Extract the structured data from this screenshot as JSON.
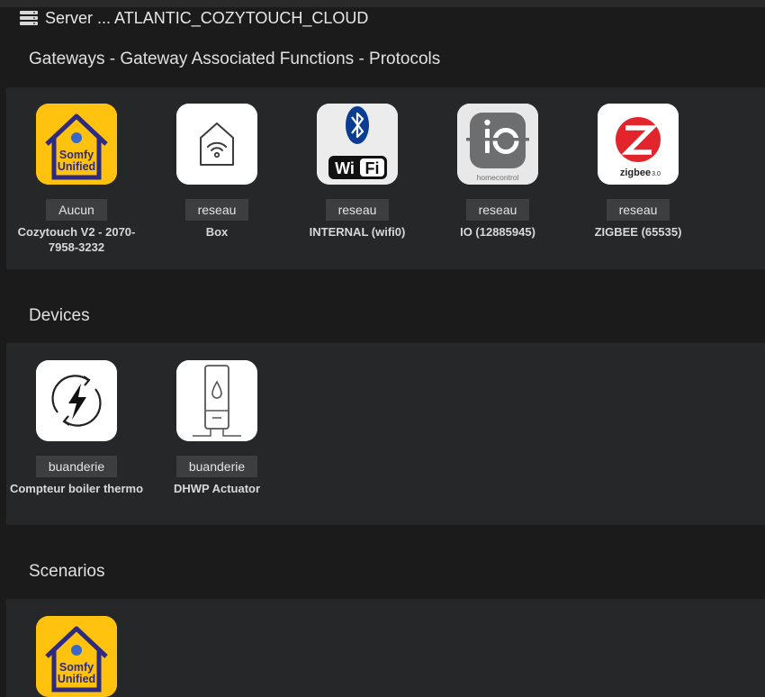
{
  "header": {
    "server_title": "Server ... ATLANTIC_COZYTOUCH_CLOUD"
  },
  "sections": {
    "gateways": {
      "title": "Gateways - Gateway Associated Functions - Protocols",
      "items": [
        {
          "badge": "Aucun",
          "label": "Cozytouch V2 - 2070-7958-3232",
          "icon": "somfy-unified-icon"
        },
        {
          "badge": "reseau",
          "label": "Box",
          "icon": "wifi-home-icon"
        },
        {
          "badge": "reseau",
          "label": "INTERNAL (wifi0)",
          "icon": "bluetooth-wifi-icon",
          "icon_text": "Wi Fi"
        },
        {
          "badge": "reseau",
          "label": "IO (12885945)",
          "icon": "io-homecontrol-icon",
          "icon_text": "homecontrol"
        },
        {
          "badge": "reseau",
          "label": "ZIGBEE (65535)",
          "icon": "zigbee-icon",
          "icon_text": "zigbee 3.0"
        }
      ]
    },
    "devices": {
      "title": "Devices",
      "items": [
        {
          "badge": "buanderie",
          "label": "Compteur boiler thermo",
          "icon": "energy-meter-icon"
        },
        {
          "badge": "buanderie",
          "label": "DHWP Actuator",
          "icon": "water-heater-icon"
        }
      ]
    },
    "scenarios": {
      "title": "Scenarios",
      "items": [
        {
          "icon": "somfy-unified-icon"
        }
      ]
    }
  },
  "logo_text": {
    "somfy_line1": "Somfy",
    "somfy_line2": "Unified"
  },
  "colors": {
    "background": "#1b1b1b",
    "panel": "#262728",
    "badge": "#3d3e40",
    "somfy_yellow": "#ffc20e",
    "somfy_blue": "#2e2a7f",
    "zigbee_red": "#e2252c",
    "bluetooth_blue": "#0a3d91"
  }
}
